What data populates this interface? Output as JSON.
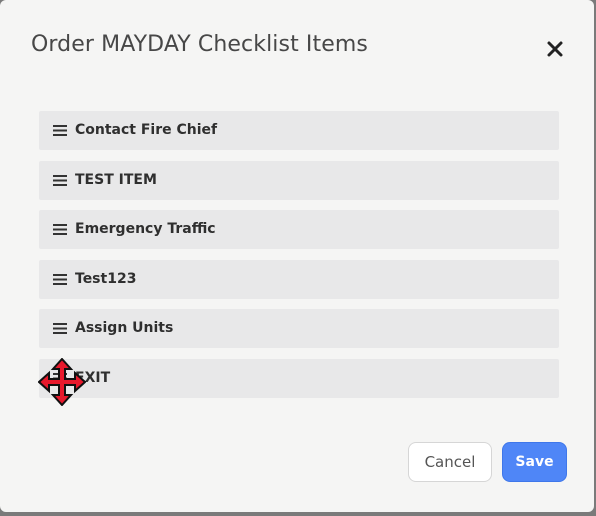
{
  "modal": {
    "title": "Order MAYDAY Checklist Items",
    "close_icon": "close-icon",
    "cancel_label": "Cancel",
    "save_label": "Save"
  },
  "checklist": {
    "handle_icon": "drag-handle-icon",
    "items": [
      {
        "label": "Contact Fire Chief"
      },
      {
        "label": "TEST ITEM"
      },
      {
        "label": "Emergency Traffic"
      },
      {
        "label": "Test123"
      },
      {
        "label": "Assign Units"
      },
      {
        "label": "EXIT"
      }
    ]
  },
  "cursor": {
    "icon": "move-cursor-icon",
    "color": "#e8192c"
  },
  "colors": {
    "primary": "#4f86f7",
    "item_bg": "#e8e8e9",
    "modal_bg": "#f5f5f4"
  }
}
